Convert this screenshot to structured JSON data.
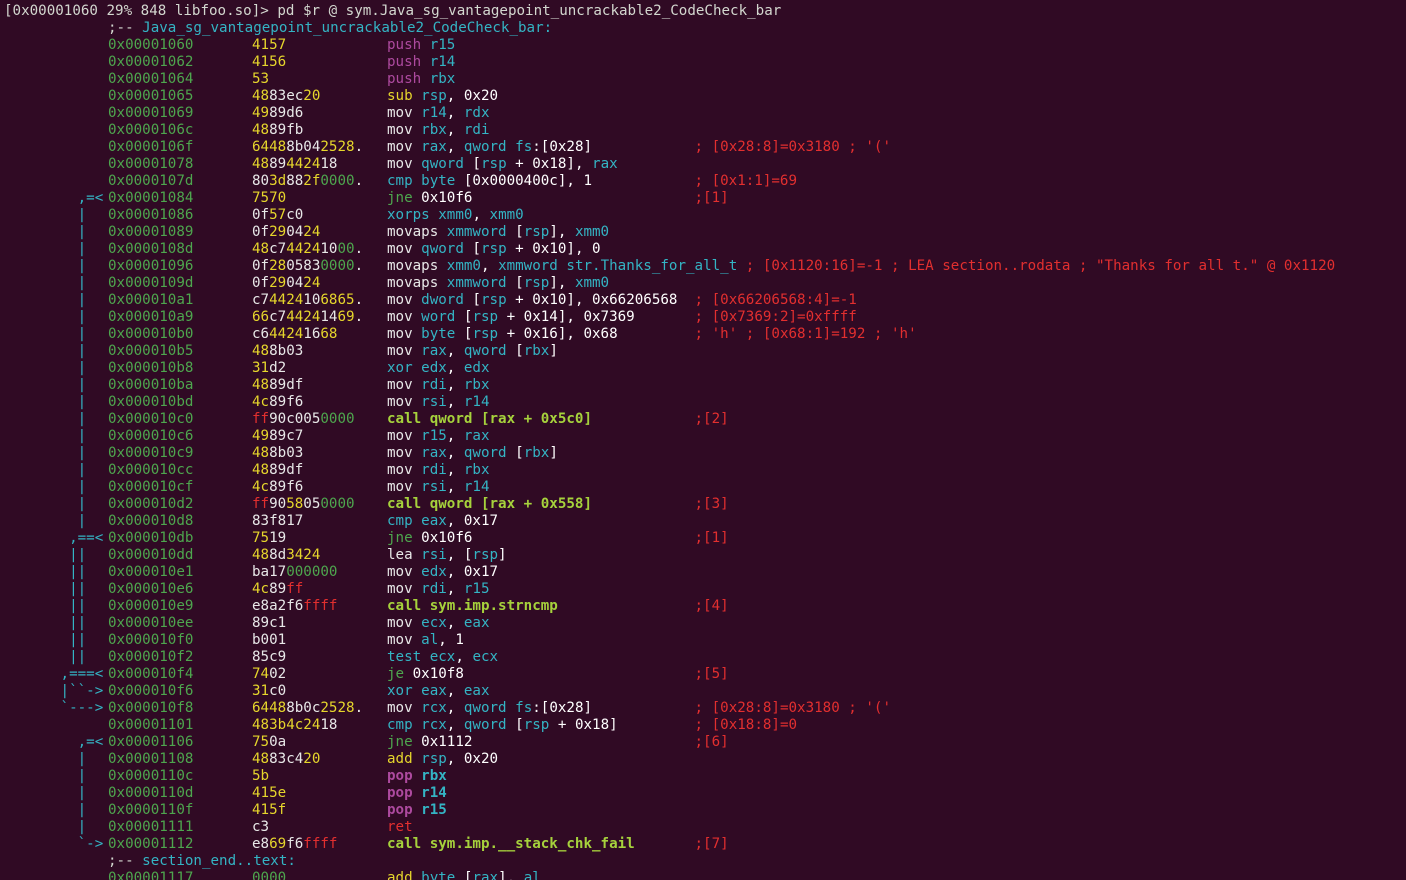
{
  "prompt": "[0x00001060 29% 848 libfoo.so]> pd $r @ sym.Java_sg_vantagepoint_uncrackable2_CodeCheck_bar",
  "function_label": {
    "prefix": ";-- ",
    "name": "Java_sg_vantagepoint_uncrackable2_CodeCheck_bar:"
  },
  "end_label": {
    "prefix": ";-- ",
    "name": "section_end..text:"
  },
  "colors": {
    "background": "#300a24",
    "address": "#4ea64e",
    "register": "#34b4c4",
    "comment": "#e22f2f",
    "call": "#a6d23c",
    "push_pop": "#ad4a9f"
  },
  "rows": [
    {
      "arrow": "",
      "addr": "0x00001060",
      "bytes": "4157",
      "mn": "push",
      "ops": "r15",
      "cmt": ""
    },
    {
      "arrow": "",
      "addr": "0x00001062",
      "bytes": "4156",
      "mn": "push",
      "ops": "r14",
      "cmt": ""
    },
    {
      "arrow": "",
      "addr": "0x00001064",
      "bytes": "53",
      "mn": "push",
      "ops": "rbx",
      "cmt": ""
    },
    {
      "arrow": "",
      "addr": "0x00001065",
      "bytes": "4883ec20",
      "mn": "sub",
      "ops": "rsp, 0x20",
      "cmt": ""
    },
    {
      "arrow": "",
      "addr": "0x00001069",
      "bytes": "4989d6",
      "mn": "mov",
      "ops": "r14, rdx",
      "cmt": ""
    },
    {
      "arrow": "",
      "addr": "0x0000106c",
      "bytes": "4889fb",
      "mn": "mov",
      "ops": "rbx, rdi",
      "cmt": ""
    },
    {
      "arrow": "",
      "addr": "0x0000106f",
      "bytes": "64488b042528.",
      "mn": "mov",
      "ops": "rax, qword fs:[0x28]",
      "cmt": "; [0x28:8]=0x3180 ; '('"
    },
    {
      "arrow": "",
      "addr": "0x00001078",
      "bytes": "4889442418",
      "mn": "mov",
      "ops": "qword [rsp + 0x18], rax",
      "cmt": ""
    },
    {
      "arrow": "",
      "addr": "0x0000107d",
      "bytes": "803d882f0000.",
      "mn": "cmp",
      "ops": "byte [0x0000400c], 1",
      "cmt": "; [0x1:1]=69"
    },
    {
      "arrow": "   ,=<",
      "addr": "0x00001084",
      "bytes": "7570",
      "mn": "jne",
      "ops": "0x10f6",
      "cmt": ";[1]"
    },
    {
      "arrow": "   |  ",
      "addr": "0x00001086",
      "bytes": "0f57c0",
      "mn": "xorps",
      "ops": "xmm0, xmm0",
      "cmt": ""
    },
    {
      "arrow": "   |  ",
      "addr": "0x00001089",
      "bytes": "0f290424",
      "mn": "movaps",
      "ops": "xmmword [rsp], xmm0",
      "cmt": ""
    },
    {
      "arrow": "   |  ",
      "addr": "0x0000108d",
      "bytes": "48c744241000.",
      "mn": "mov",
      "ops": "qword [rsp + 0x10], 0",
      "cmt": ""
    },
    {
      "arrow": "   |  ",
      "addr": "0x00001096",
      "bytes": "0f2805830000.",
      "mn": "movaps",
      "ops": "xmm0, xmmword str.Thanks_for_all_t",
      "cmt": "; [0x1120:16]=-1 ; LEA section..rodata ; \"Thanks for all t.\" @ 0x1120"
    },
    {
      "arrow": "   |  ",
      "addr": "0x0000109d",
      "bytes": "0f290424",
      "mn": "movaps",
      "ops": "xmmword [rsp], xmm0",
      "cmt": ""
    },
    {
      "arrow": "   |  ",
      "addr": "0x000010a1",
      "bytes": "c74424106865.",
      "mn": "mov",
      "ops": "dword [rsp + 0x10], 0x66206568",
      "cmt": "; [0x66206568:4]=-1"
    },
    {
      "arrow": "   |  ",
      "addr": "0x000010a9",
      "bytes": "66c744241469.",
      "mn": "mov",
      "ops": "word [rsp + 0x14], 0x7369",
      "cmt": "; [0x7369:2]=0xffff"
    },
    {
      "arrow": "   |  ",
      "addr": "0x000010b0",
      "bytes": "c644241668",
      "mn": "mov",
      "ops": "byte [rsp + 0x16], 0x68",
      "cmt": "; 'h' ; [0x68:1]=192 ; 'h'"
    },
    {
      "arrow": "   |  ",
      "addr": "0x000010b5",
      "bytes": "488b03",
      "mn": "mov",
      "ops": "rax, qword [rbx]",
      "cmt": ""
    },
    {
      "arrow": "   |  ",
      "addr": "0x000010b8",
      "bytes": "31d2",
      "mn": "xor",
      "ops": "edx, edx",
      "cmt": ""
    },
    {
      "arrow": "   |  ",
      "addr": "0x000010ba",
      "bytes": "4889df",
      "mn": "mov",
      "ops": "rdi, rbx",
      "cmt": ""
    },
    {
      "arrow": "   |  ",
      "addr": "0x000010bd",
      "bytes": "4c89f6",
      "mn": "mov",
      "ops": "rsi, r14",
      "cmt": ""
    },
    {
      "arrow": "   |  ",
      "addr": "0x000010c0",
      "bytes": "ff90c0050000",
      "mn": "call",
      "ops": "qword [rax + 0x5c0]",
      "cmt": ";[2]"
    },
    {
      "arrow": "   |  ",
      "addr": "0x000010c6",
      "bytes": "4989c7",
      "mn": "mov",
      "ops": "r15, rax",
      "cmt": ""
    },
    {
      "arrow": "   |  ",
      "addr": "0x000010c9",
      "bytes": "488b03",
      "mn": "mov",
      "ops": "rax, qword [rbx]",
      "cmt": ""
    },
    {
      "arrow": "   |  ",
      "addr": "0x000010cc",
      "bytes": "4889df",
      "mn": "mov",
      "ops": "rdi, rbx",
      "cmt": ""
    },
    {
      "arrow": "   |  ",
      "addr": "0x000010cf",
      "bytes": "4c89f6",
      "mn": "mov",
      "ops": "rsi, r14",
      "cmt": ""
    },
    {
      "arrow": "   |  ",
      "addr": "0x000010d2",
      "bytes": "ff9058050000",
      "mn": "call",
      "ops": "qword [rax + 0x558]",
      "cmt": ";[3]"
    },
    {
      "arrow": "   |  ",
      "addr": "0x000010d8",
      "bytes": "83f817",
      "mn": "cmp",
      "ops": "eax, 0x17",
      "cmt": ""
    },
    {
      "arrow": "  ,==<",
      "addr": "0x000010db",
      "bytes": "7519",
      "mn": "jne",
      "ops": "0x10f6",
      "cmt": ";[1]"
    },
    {
      "arrow": "  ||  ",
      "addr": "0x000010dd",
      "bytes": "488d3424",
      "mn": "lea",
      "ops": "rsi, [rsp]",
      "cmt": ""
    },
    {
      "arrow": "  ||  ",
      "addr": "0x000010e1",
      "bytes": "ba17000000",
      "mn": "mov",
      "ops": "edx, 0x17",
      "cmt": ""
    },
    {
      "arrow": "  ||  ",
      "addr": "0x000010e6",
      "bytes": "4c89ff",
      "mn": "mov",
      "ops": "rdi, r15",
      "cmt": ""
    },
    {
      "arrow": "  ||  ",
      "addr": "0x000010e9",
      "bytes": "e8a2f6ffff",
      "mn": "call",
      "ops": "sym.imp.strncmp",
      "cmt": ";[4]"
    },
    {
      "arrow": "  ||  ",
      "addr": "0x000010ee",
      "bytes": "89c1",
      "mn": "mov",
      "ops": "ecx, eax",
      "cmt": ""
    },
    {
      "arrow": "  ||  ",
      "addr": "0x000010f0",
      "bytes": "b001",
      "mn": "mov",
      "ops": "al, 1",
      "cmt": ""
    },
    {
      "arrow": "  ||  ",
      "addr": "0x000010f2",
      "bytes": "85c9",
      "mn": "test",
      "ops": "ecx, ecx",
      "cmt": ""
    },
    {
      "arrow": " ,===<",
      "addr": "0x000010f4",
      "bytes": "7402",
      "mn": "je",
      "ops": "0x10f8",
      "cmt": ";[5]"
    },
    {
      "arrow": " |``->",
      "addr": "0x000010f6",
      "bytes": "31c0",
      "mn": "xor",
      "ops": "eax, eax",
      "cmt": ""
    },
    {
      "arrow": " `--->",
      "addr": "0x000010f8",
      "bytes": "64488b0c2528.",
      "mn": "mov",
      "ops": "rcx, qword fs:[0x28]",
      "cmt": "; [0x28:8]=0x3180 ; '('"
    },
    {
      "arrow": "",
      "addr": "0x00001101",
      "bytes": "483b4c2418",
      "mn": "cmp",
      "ops": "rcx, qword [rsp + 0x18]",
      "cmt": "; [0x18:8]=0"
    },
    {
      "arrow": "   ,=<",
      "addr": "0x00001106",
      "bytes": "750a",
      "mn": "jne",
      "ops": "0x1112",
      "cmt": ";[6]"
    },
    {
      "arrow": "   |  ",
      "addr": "0x00001108",
      "bytes": "4883c420",
      "mn": "add",
      "ops": "rsp, 0x20",
      "cmt": ""
    },
    {
      "arrow": "   |  ",
      "addr": "0x0000110c",
      "bytes": "5b",
      "mn": "pop",
      "ops": "rbx",
      "cmt": ""
    },
    {
      "arrow": "   |  ",
      "addr": "0x0000110d",
      "bytes": "415e",
      "mn": "pop",
      "ops": "r14",
      "cmt": ""
    },
    {
      "arrow": "   |  ",
      "addr": "0x0000110f",
      "bytes": "415f",
      "mn": "pop",
      "ops": "r15",
      "cmt": ""
    },
    {
      "arrow": "   |  ",
      "addr": "0x00001111",
      "bytes": "c3",
      "mn": "ret",
      "ops": "",
      "cmt": ""
    },
    {
      "arrow": "   `->",
      "addr": "0x00001112",
      "bytes": "e869f6ffff",
      "mn": "call",
      "ops": "sym.imp.__stack_chk_fail",
      "cmt": ";[7]"
    }
  ],
  "trailing_row": {
    "addr": "0x00001117",
    "bytes": "0000",
    "mn": "add",
    "ops": "byte [rax], al"
  }
}
